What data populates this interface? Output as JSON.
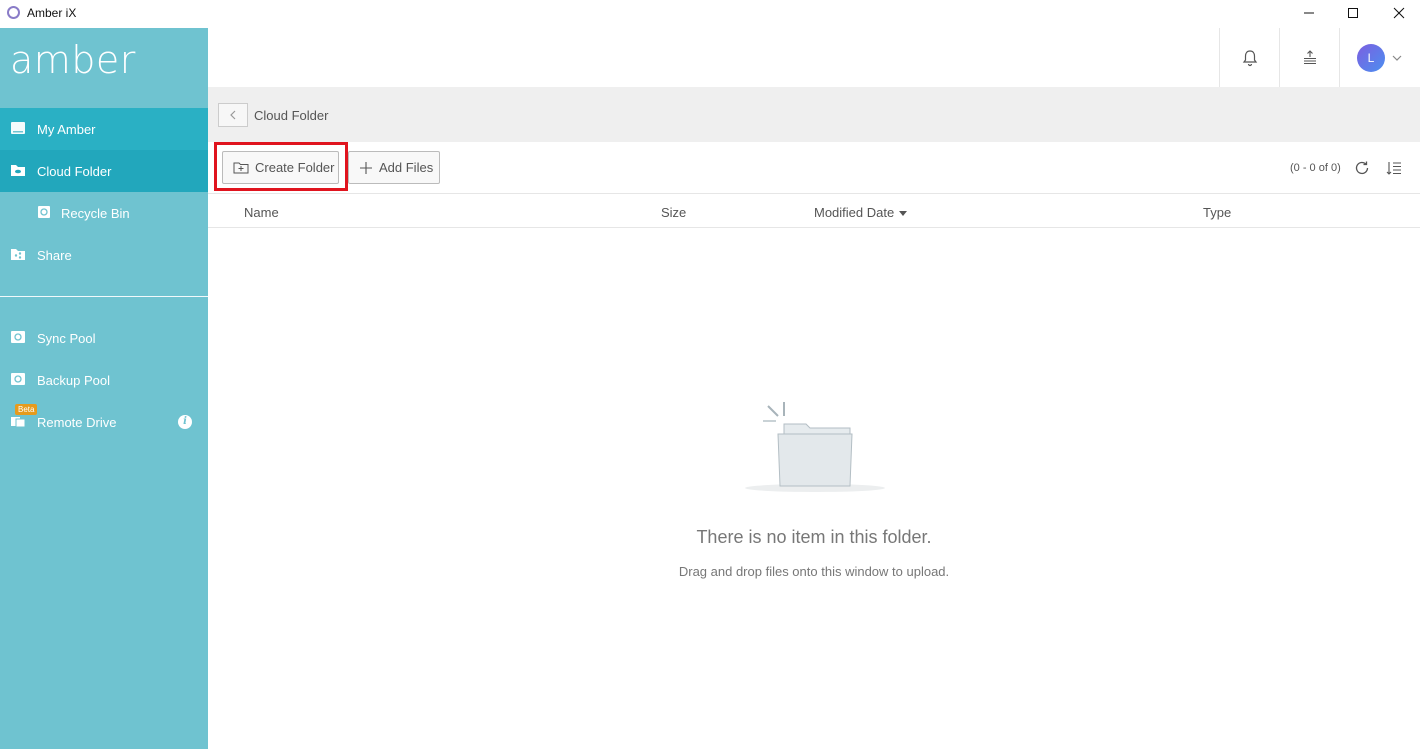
{
  "window": {
    "title": "Amber iX"
  },
  "sidebar": {
    "logo": "amber",
    "items": [
      {
        "label": "My Amber"
      },
      {
        "label": "Cloud Folder"
      },
      {
        "label": "Recycle Bin"
      },
      {
        "label": "Share"
      },
      {
        "label": "Sync Pool"
      },
      {
        "label": "Backup Pool"
      },
      {
        "label": "Remote Drive",
        "badge": "Beta"
      }
    ]
  },
  "header": {
    "avatar_initial": "L"
  },
  "breadcrumb": {
    "current": "Cloud Folder"
  },
  "toolbar": {
    "create_folder_label": "Create Folder",
    "add_files_label": "Add Files",
    "counter": "(0 - 0 of 0)"
  },
  "table": {
    "columns": [
      "Name",
      "Size",
      "Modified Date",
      "Type"
    ]
  },
  "empty_state": {
    "title": "There is no item in this folder.",
    "subtitle": "Drag and drop files onto this window to upload."
  },
  "colors": {
    "sidebar_bg": "#6fc3d0",
    "sidebar_active": "#22a7bc",
    "highlight": "#e0141e"
  }
}
